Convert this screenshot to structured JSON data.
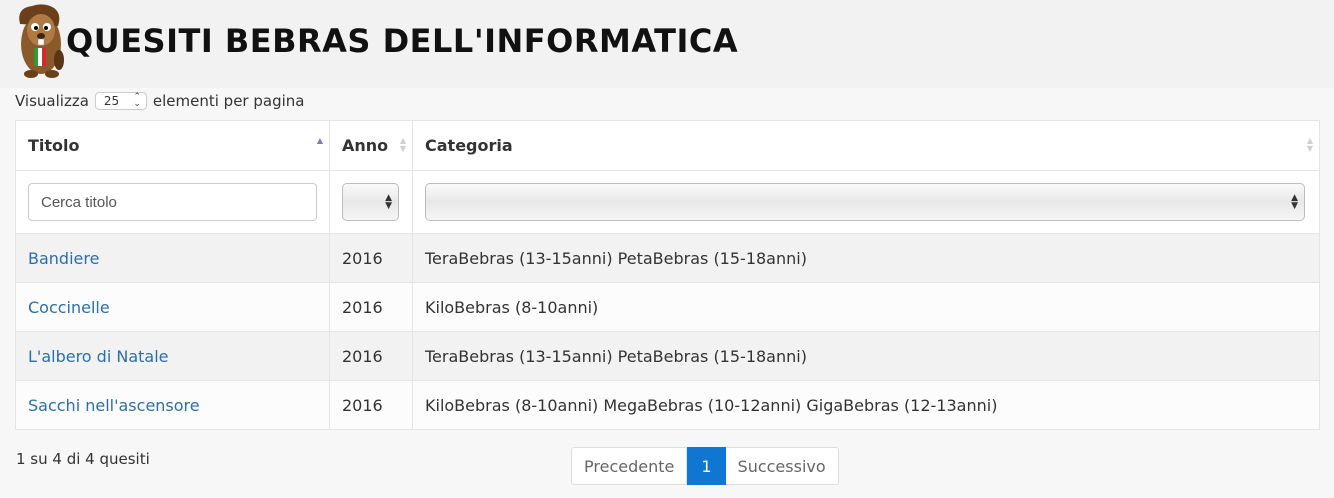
{
  "header": {
    "title": "QUESITI BEBRAS DELL'INFORMATICA",
    "logo_icon": "beaver-mascot-icon"
  },
  "length_control": {
    "prefix": "Visualizza",
    "value": "25",
    "suffix": "elementi per pagina"
  },
  "table": {
    "columns": [
      {
        "label": "Titolo",
        "sort": "ascending"
      },
      {
        "label": "Anno",
        "sort": "none"
      },
      {
        "label": "Categoria",
        "sort": "none"
      }
    ],
    "filters": {
      "title_placeholder": "Cerca titolo",
      "year_value": "",
      "category_value": ""
    },
    "rows": [
      {
        "title": "Bandiere",
        "year": "2016",
        "category": "TeraBebras (13-15anni) PetaBebras (15-18anni)"
      },
      {
        "title": "Coccinelle",
        "year": "2016",
        "category": "KiloBebras (8-10anni)"
      },
      {
        "title": "L'albero di Natale",
        "year": "2016",
        "category": "TeraBebras (13-15anni) PetaBebras (15-18anni)"
      },
      {
        "title": "Sacchi nell'ascensore",
        "year": "2016",
        "category": "KiloBebras (8-10anni) MegaBebras (10-12anni) GigaBebras (12-13anni)"
      }
    ]
  },
  "footer": {
    "info": "1 su 4 di 4 quesiti",
    "pagination": {
      "prev_label": "Precedente",
      "current_page": "1",
      "next_label": "Successivo"
    }
  },
  "colors": {
    "link": "#2a6fb0",
    "active_page": "#0f76d1",
    "sort_active": "#7b7bbf"
  }
}
